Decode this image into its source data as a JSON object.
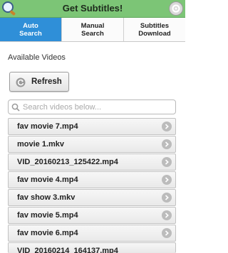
{
  "header": {
    "title": "Get Subtitles!",
    "app_icon": "search-magnifier-icon",
    "settings_icon": "gear-icon",
    "accent_color": "#7cc576"
  },
  "tabs": [
    {
      "label": "Auto\nSearch",
      "active": true
    },
    {
      "label": "Manual\nSearch",
      "active": false
    },
    {
      "label": "Subtitles\nDownload",
      "active": false
    }
  ],
  "active_tab_color": "#2f8fd8",
  "main": {
    "section_label": "Available Videos",
    "refresh_label": "Refresh",
    "search_placeholder": "Search videos below...",
    "search_value": ""
  },
  "videos": [
    "fav movie 7.mp4",
    "movie 1.mkv",
    "VID_20160213_125422.mp4",
    "fav movie 4.mp4",
    "fav show 3.mkv",
    "fav movie 5.mp4",
    "fav movie 6.mp4",
    "VID_20160214_164137.mp4"
  ]
}
